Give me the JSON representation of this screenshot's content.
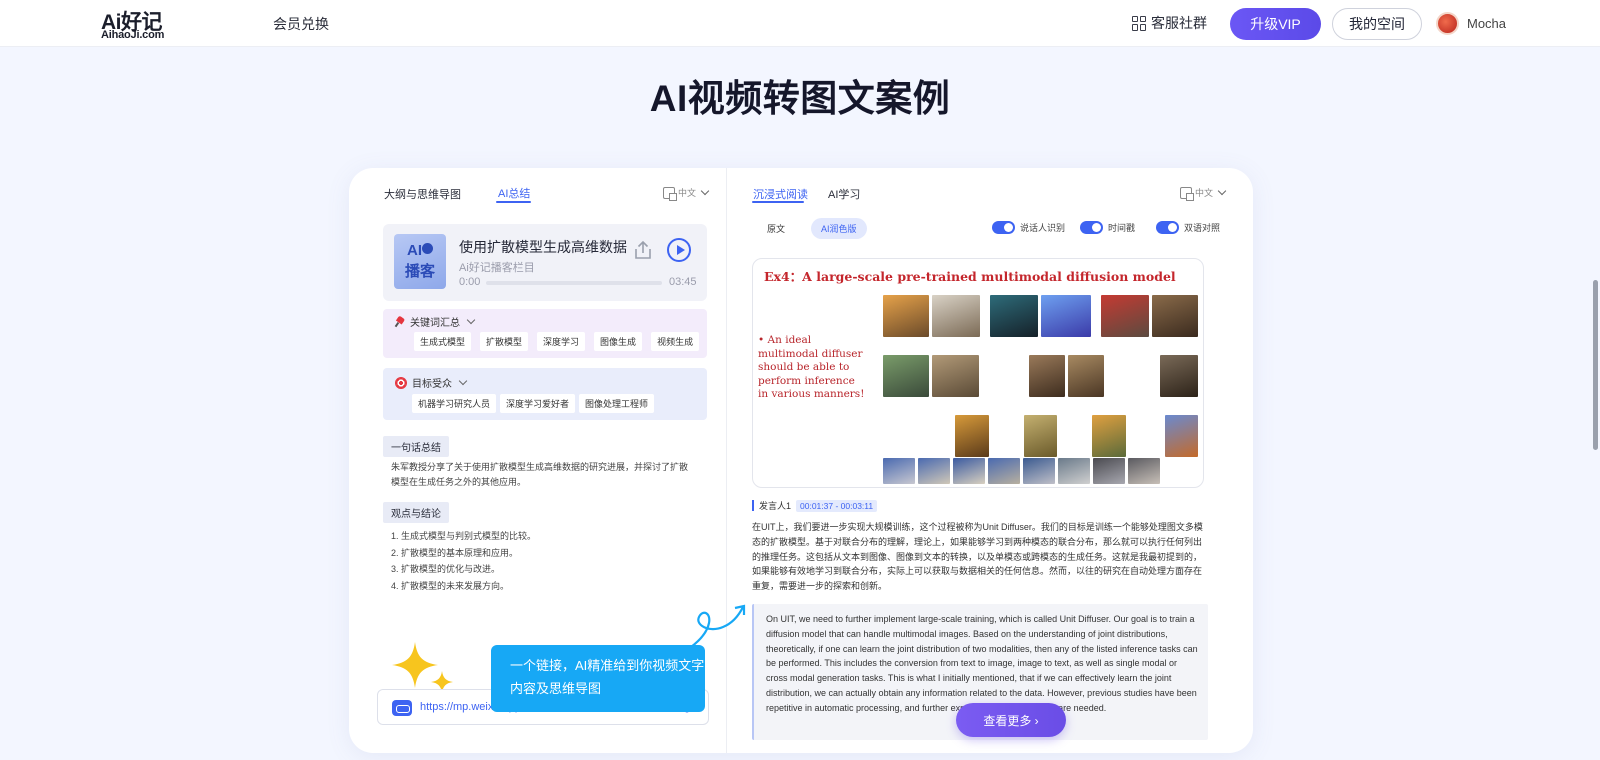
{
  "nav": {
    "logo_top": "Ai好记",
    "logo_bottom": "AihaoJi.com",
    "link": "会员兑换",
    "community": "客服社群",
    "vip": "升级VIP",
    "space": "我的空间",
    "user": "Mocha"
  },
  "title": "AI视频转图文案例",
  "left": {
    "tabs": [
      "大纲与思维导图",
      "AI总结"
    ],
    "lang": "中文",
    "podcast": {
      "badge_top": "AI",
      "badge_bottom": "播客",
      "title": "使用扩散模型生成高维数据",
      "subtitle": "Ai好记播客栏目",
      "current": "0:00",
      "duration": "03:45",
      "progress": 0
    },
    "keywords": {
      "heading": "关键词汇总",
      "items": [
        "生成式模型",
        "扩散模型",
        "深度学习",
        "图像生成",
        "视频生成"
      ]
    },
    "audience": {
      "heading": "目标受众",
      "items": [
        "机器学习研究人员",
        "深度学习爱好者",
        "图像处理工程师"
      ]
    },
    "summary_tag": "一句话总结",
    "summary": "朱军教授分享了关于使用扩散模型生成高维数据的研究进展，并探讨了扩散模型在生成任务之外的其他应用。",
    "points_tag": "观点与结论",
    "points": [
      "1. 生成式模型与判别式模型的比较。",
      "2. 扩散模型的基本原理和应用。",
      "3. 扩散模型的优化与改进。",
      "4. 扩散模型的未来发展方向。"
    ],
    "tip": "一个链接，AI精准给到你视频文字内容及思维导图",
    "url": "https://mp.weixin.qq.com/s/Ju6GLJhe4VOnwx6hvOCkg"
  },
  "right": {
    "tabs": [
      "沉浸式阅读",
      "AI学习"
    ],
    "lang": "中文",
    "subtabs": [
      "原文",
      "AI润色版"
    ],
    "toggles": [
      "说话人识别",
      "时间戳",
      "双语对照"
    ],
    "slide": {
      "title": "Ex4：A large-scale pre-trained multimodal diffusion model",
      "left_text": "• An ideal multimodal diffuser should be able to perform inference in various manners!"
    },
    "speaker": "发言人1",
    "time": "00:01:37 - 00:03:11",
    "zh": "在UIT上，我们要进一步实现大规模训练，这个过程被称为Unit Diffuser。我们的目标是训练一个能够处理图文多模态的扩散模型。基于对联合分布的理解，理论上，如果能够学习到两种模态的联合分布，那么就可以执行任何列出的推理任务。这包括从文本到图像、图像到文本的转换，以及单模态或跨模态的生成任务。这就是我最初提到的，如果能够有效地学习到联合分布，实际上可以获取与数据相关的任何信息。然而，以往的研究在自动处理方面存在重复，需要进一步的探索和创新。",
    "en": "On UIT, we need to further implement large-scale training, which is called Unit Diffuser. Our goal is to train a diffusion model that can handle multimodal images. Based on the understanding of joint distributions, theoretically, if one can learn the joint distribution of two modalities, then any of the listed inference tasks can be performed. This includes the conversion from text to image, image to text, as well as single modal or cross modal generation tasks. This is what I initially mentioned, that if we can effectively learn the joint distribution, we can actually obtain any information related to the data. However, previous studies have been repetitive in automatic processing, and further exploration and innovation are needed.",
    "more": "查看更多 ›"
  },
  "colors": {
    "accent": "#3d63f2",
    "vip": "#6b57f5",
    "tip": "#17a8f5"
  }
}
